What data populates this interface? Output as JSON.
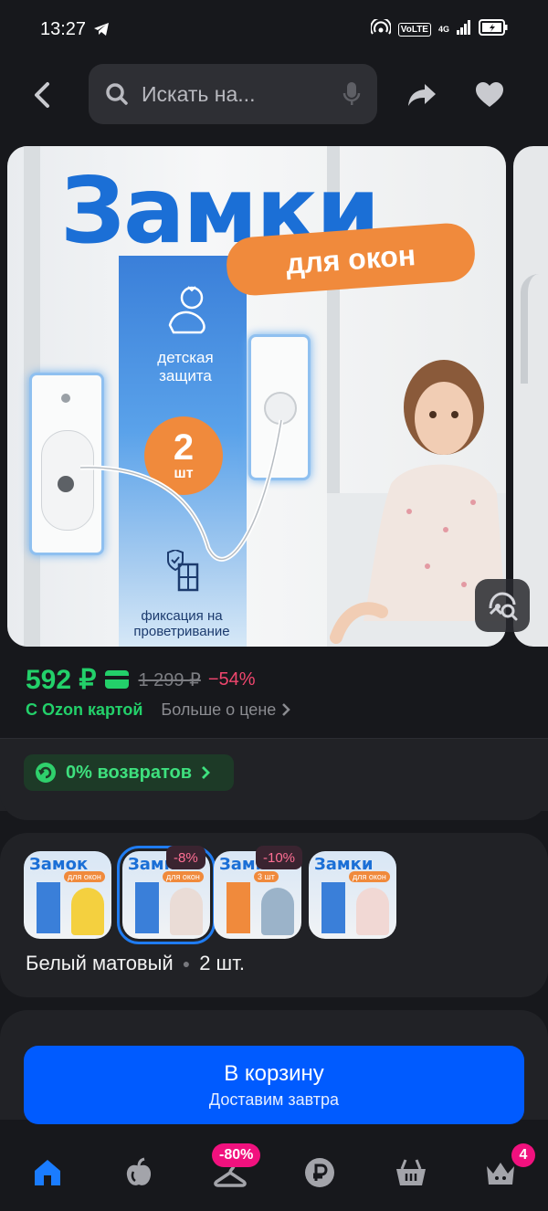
{
  "status_bar": {
    "time": "13:27",
    "volte": "VoLTE",
    "network": "4G"
  },
  "search": {
    "placeholder": "Искать на..."
  },
  "gallery": {
    "title": "Замки",
    "subtitle": "для окон",
    "feature1": "детская защита",
    "count_number": "2",
    "count_unit": "шт",
    "feature2": "фиксация на проветривание"
  },
  "price": {
    "current": "592 ₽",
    "old": "1 299 ₽",
    "discount": "−54%",
    "ozon_card": "С Ozon картой",
    "more": "Больше о цене"
  },
  "returns": {
    "label": "0% возвратов"
  },
  "variants": {
    "items": [
      {
        "title": "Замок",
        "sub": "для окон",
        "badge": ""
      },
      {
        "title": "Замки",
        "sub": "для окон",
        "badge": "-8%"
      },
      {
        "title": "Замки",
        "sub": "3 шт",
        "badge": "-10%"
      },
      {
        "title": "Замки",
        "sub": "для окон",
        "badge": ""
      }
    ],
    "selected_color": "Белый матовый",
    "selected_qty": "2 шт."
  },
  "cart": {
    "label": "В корзину",
    "sub": "Доставим завтра"
  },
  "nav": {
    "promo_badge": "-80%",
    "profile_count": "4"
  },
  "colors": {
    "accent_blue": "#005bff",
    "price_green": "#23d06a",
    "discount_pink": "#f0466e",
    "badge_magenta": "#f1117e"
  }
}
